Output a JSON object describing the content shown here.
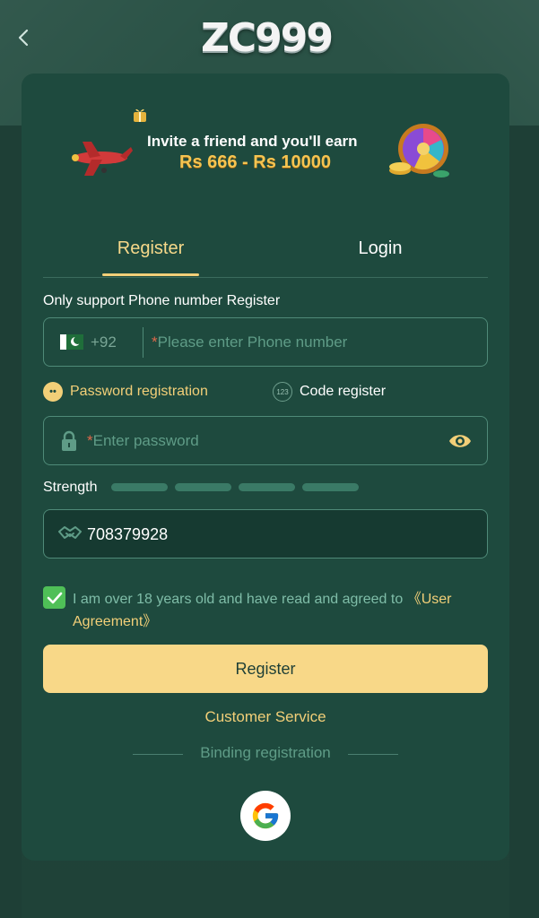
{
  "header": {
    "logo_text": "ZC999"
  },
  "banner": {
    "line1": "Invite a friend and you'll earn",
    "line2": "Rs 666 - Rs 10000"
  },
  "tabs": [
    {
      "label": "Register",
      "active": true
    },
    {
      "label": "Login",
      "active": false
    }
  ],
  "form": {
    "hint": "Only support Phone number Register",
    "phone": {
      "country_code": "+92",
      "required_mark": "*",
      "placeholder": "Please enter Phone number"
    },
    "options": {
      "password_label": "Password registration",
      "code_label": "Code register",
      "code_badge": "123"
    },
    "password": {
      "required_mark": "*",
      "placeholder": "Enter password"
    },
    "strength_label": "Strength",
    "invite_code": "708379928",
    "agreement": {
      "checked": true,
      "text": "I am over 18 years old and have read and agreed to ",
      "link": "《User Agreement》"
    },
    "submit_label": "Register",
    "customer_service": "Customer Service",
    "binding_label": "Binding registration"
  },
  "colors": {
    "accent": "#f2cf78",
    "background": "#1e4a3e",
    "button": "#f8d888",
    "checkbox": "#4fbf57"
  }
}
